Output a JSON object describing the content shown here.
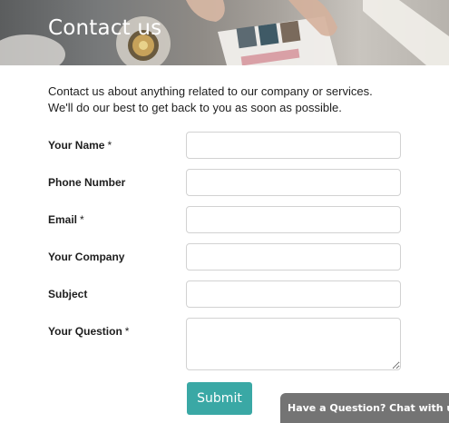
{
  "banner": {
    "title": "Contact us"
  },
  "intro": {
    "line1": "Contact us about anything related to our company or services.",
    "line2": "We'll do our best to get back to you as soon as possible."
  },
  "form": {
    "required_mark": "*",
    "fields": {
      "name": {
        "label": "Your Name",
        "required": true,
        "value": ""
      },
      "phone": {
        "label": "Phone Number",
        "required": false,
        "value": ""
      },
      "email": {
        "label": "Email",
        "required": true,
        "value": ""
      },
      "company": {
        "label": "Your Company",
        "required": false,
        "value": ""
      },
      "subject": {
        "label": "Subject",
        "required": false,
        "value": ""
      },
      "question": {
        "label": "Your Question",
        "required": true,
        "value": ""
      }
    },
    "submit_label": "Submit"
  },
  "chat": {
    "label": "Have a Question? Chat with us."
  },
  "colors": {
    "accent": "#3aa8a5",
    "chat_background": "#747474",
    "input_border": "#d2d2d2"
  }
}
